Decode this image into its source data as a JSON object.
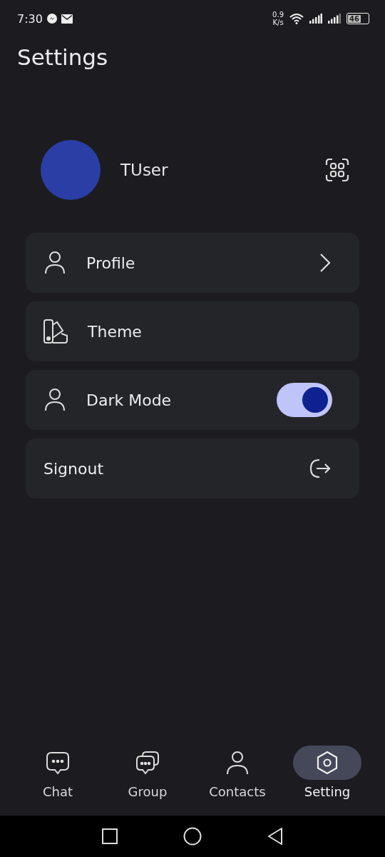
{
  "status_bar": {
    "time": "7:30",
    "speed_value": "0.9",
    "speed_unit": "K/s",
    "battery": "46"
  },
  "title": "Settings",
  "user": {
    "name": "TUser"
  },
  "menu": [
    {
      "kind": "link",
      "label": "Profile"
    },
    {
      "kind": "theme",
      "label": "Theme"
    },
    {
      "kind": "toggle",
      "label": "Dark Mode",
      "on": true
    },
    {
      "kind": "signout",
      "label": "Signout"
    }
  ],
  "nav": [
    {
      "kind": "chat",
      "label": "Chat",
      "selected": false
    },
    {
      "kind": "group",
      "label": "Group",
      "selected": false
    },
    {
      "kind": "contacts",
      "label": "Contacts",
      "selected": false
    },
    {
      "kind": "setting",
      "label": "Setting",
      "selected": true
    }
  ]
}
